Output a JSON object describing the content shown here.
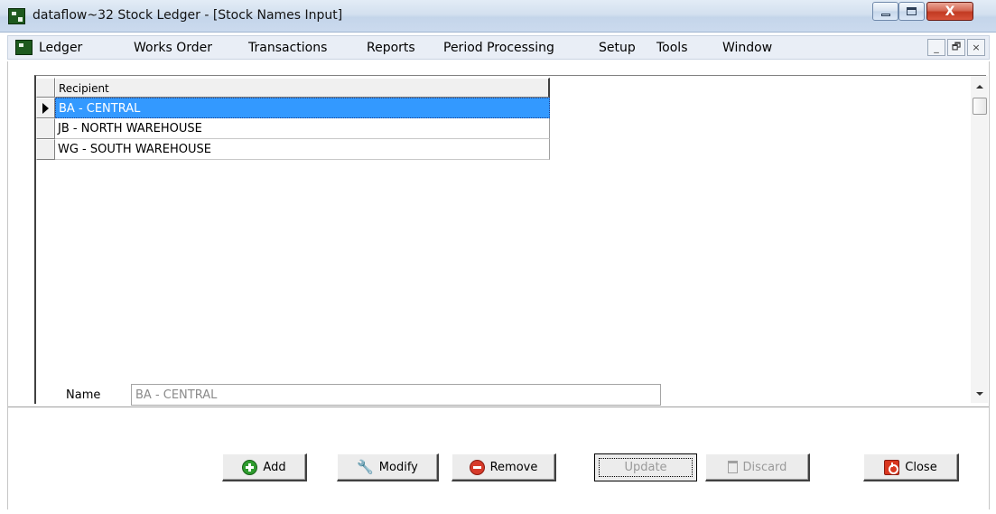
{
  "window": {
    "title": "dataflow~32 Stock Ledger - [Stock Names Input]",
    "close_glyph": "X"
  },
  "menu": {
    "items": [
      {
        "label": "Ledger",
        "underline": "L"
      },
      {
        "label": "Works Order",
        "underline": "W"
      },
      {
        "label": "Transactions",
        "underline": "T"
      },
      {
        "label": "Reports",
        "underline": "R"
      },
      {
        "label": "Period Processing",
        "underline": "P"
      },
      {
        "label": "Setup",
        "underline": "S"
      },
      {
        "label": "Tools",
        "underline": "o"
      },
      {
        "label": "Window",
        "underline": "W"
      }
    ],
    "mdi_min": "_",
    "mdi_restore": "🗗",
    "mdi_close": "×"
  },
  "grid": {
    "column_header": "Recipient",
    "rows": [
      {
        "value": "BA - CENTRAL",
        "selected": true
      },
      {
        "value": "JB - NORTH WAREHOUSE",
        "selected": false
      },
      {
        "value": "WG - SOUTH WAREHOUSE",
        "selected": false
      }
    ]
  },
  "form": {
    "name_label": "Name",
    "name_value": "BA - CENTRAL"
  },
  "buttons": {
    "add": "Add",
    "modify": "Modify",
    "remove": "Remove",
    "update": "Update",
    "discard": "Discard",
    "close": "Close"
  },
  "icons": {
    "app": "dataflow-app-icon",
    "add": "green-plus-circle-icon",
    "modify": "wrench-icon",
    "remove": "red-minus-circle-icon",
    "discard": "trash-icon",
    "close": "power-icon"
  },
  "colors": {
    "selection": "#3399ff",
    "title_gradient": "#c4d5ea",
    "close_button": "#c13a22"
  }
}
